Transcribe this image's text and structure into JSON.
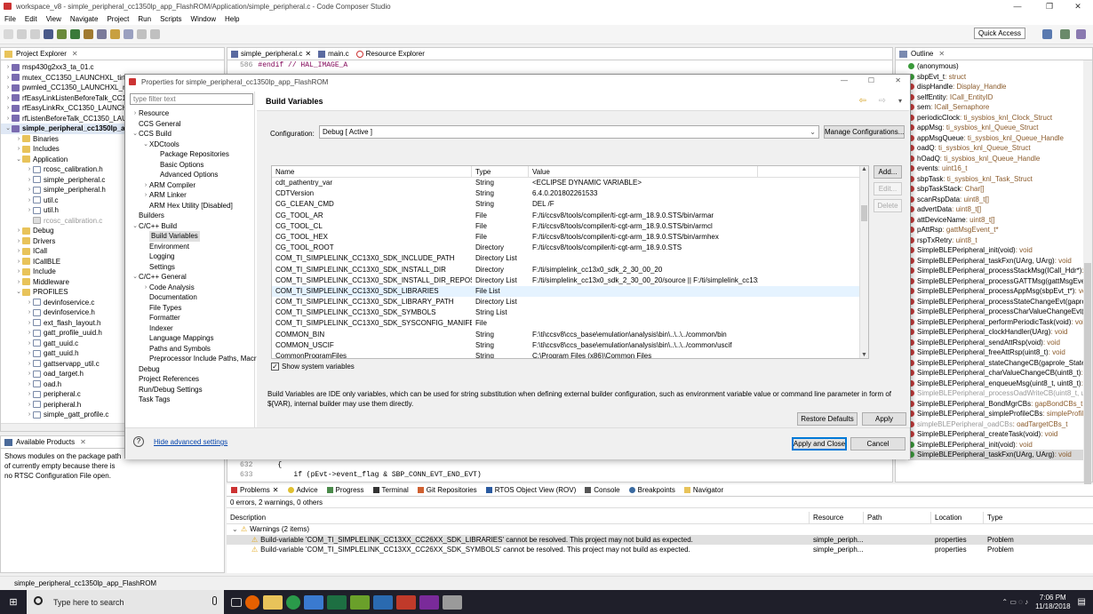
{
  "window": {
    "title": "workspace_v8 - simple_peripheral_cc1350lp_app_FlashROM/Application/simple_peripheral.c - Code Composer Studio"
  },
  "menu": [
    "File",
    "Edit",
    "View",
    "Navigate",
    "Project",
    "Run",
    "Scripts",
    "Window",
    "Help"
  ],
  "quick_access": "Quick Access",
  "project_explorer": {
    "tab": "Project Explorer",
    "items": [
      {
        "label": "msp430g2xx3_ta_01.c",
        "indent": 0,
        "icon": "proj",
        "tw": "›"
      },
      {
        "label": "mutex_CC1350_LAUNCHXL_tirto",
        "indent": 0,
        "icon": "proj",
        "tw": "›"
      },
      {
        "label": "pwmled_CC1350_LAUNCHXL_ne",
        "indent": 0,
        "icon": "proj",
        "tw": "›"
      },
      {
        "label": "rfEasyLinkListenBeforeTalk_CC13",
        "indent": 0,
        "icon": "proj",
        "tw": "›"
      },
      {
        "label": "rfEasyLinkRx_CC1350_LAUNCHX",
        "indent": 0,
        "icon": "proj",
        "tw": "›"
      },
      {
        "label": "rfListenBeforeTalk_CC1350_LAUN",
        "indent": 0,
        "icon": "proj",
        "tw": "›"
      },
      {
        "label": "simple_peripheral_cc1350lp_ap",
        "indent": 0,
        "icon": "proj",
        "tw": "⌄",
        "bold": true
      },
      {
        "label": "Binaries",
        "indent": 1,
        "icon": "folder",
        "tw": "›"
      },
      {
        "label": "Includes",
        "indent": 1,
        "icon": "folder",
        "tw": "›"
      },
      {
        "label": "Application",
        "indent": 1,
        "icon": "folder",
        "tw": "⌄"
      },
      {
        "label": "rcosc_calibration.h",
        "indent": 2,
        "icon": "file",
        "tw": "›"
      },
      {
        "label": "simple_peripheral.c",
        "indent": 2,
        "icon": "file",
        "tw": "›"
      },
      {
        "label": "simple_peripheral.h",
        "indent": 2,
        "icon": "file",
        "tw": "›"
      },
      {
        "label": "util.c",
        "indent": 2,
        "icon": "file",
        "tw": "›"
      },
      {
        "label": "util.h",
        "indent": 2,
        "icon": "file",
        "tw": "›"
      },
      {
        "label": "rcosc_calibration.c",
        "indent": 2,
        "icon": "grey",
        "tw": "",
        "grey": true
      },
      {
        "label": "Debug",
        "indent": 1,
        "icon": "folder",
        "tw": "›"
      },
      {
        "label": "Drivers",
        "indent": 1,
        "icon": "folder",
        "tw": "›"
      },
      {
        "label": "ICall",
        "indent": 1,
        "icon": "folder",
        "tw": "›"
      },
      {
        "label": "ICallBLE",
        "indent": 1,
        "icon": "folder",
        "tw": "›"
      },
      {
        "label": "Include",
        "indent": 1,
        "icon": "folder",
        "tw": "›"
      },
      {
        "label": "Middleware",
        "indent": 1,
        "icon": "folder",
        "tw": "›"
      },
      {
        "label": "PROFILES",
        "indent": 1,
        "icon": "folder",
        "tw": "⌄"
      },
      {
        "label": "devinfoservice.c",
        "indent": 2,
        "icon": "file",
        "tw": "›"
      },
      {
        "label": "devinfoservice.h",
        "indent": 2,
        "icon": "file",
        "tw": "›"
      },
      {
        "label": "ext_flash_layout.h",
        "indent": 2,
        "icon": "file",
        "tw": "›"
      },
      {
        "label": "gatt_profile_uuid.h",
        "indent": 2,
        "icon": "file",
        "tw": "›"
      },
      {
        "label": "gatt_uuid.c",
        "indent": 2,
        "icon": "file",
        "tw": "›"
      },
      {
        "label": "gatt_uuid.h",
        "indent": 2,
        "icon": "file",
        "tw": "›"
      },
      {
        "label": "gattservapp_util.c",
        "indent": 2,
        "icon": "file",
        "tw": "›"
      },
      {
        "label": "oad_target.h",
        "indent": 2,
        "icon": "file",
        "tw": "›"
      },
      {
        "label": "oad.h",
        "indent": 2,
        "icon": "file",
        "tw": "›"
      },
      {
        "label": "peripheral.c",
        "indent": 2,
        "icon": "file",
        "tw": "›"
      },
      {
        "label": "peripheral.h",
        "indent": 2,
        "icon": "file",
        "tw": "›"
      },
      {
        "label": "simple_gatt_profile.c",
        "indent": 2,
        "icon": "file",
        "tw": "›"
      }
    ]
  },
  "available_products": {
    "tab": "Available Products",
    "text": "Shows modules on the package path of currently empty because there is no RTSC Configuration File open."
  },
  "editor": {
    "tabs": [
      "simple_peripheral.c",
      "main.c",
      "Resource Explorer"
    ],
    "top_line_no": "586",
    "top_line": "#endif // HAL_IMAGE_A",
    "bottom_lines": [
      {
        "no": "632",
        "code": "{"
      },
      {
        "no": "633",
        "code": "if (pEvt->event_flag & SBP_CONN_EVT_END_EVT)"
      }
    ]
  },
  "outline": {
    "tab": "Outline",
    "items": [
      {
        "name": "(anonymous)",
        "type": "",
        "dot": "g"
      },
      {
        "name": "sbpEvt_t",
        "type": " : struct",
        "dot": "g"
      },
      {
        "name": "dispHandle",
        "type": " : Display_Handle",
        "dot": "r"
      },
      {
        "name": "selfEntity",
        "type": " : ICall_EntityID",
        "dot": "r"
      },
      {
        "name": "sem",
        "type": " : ICall_Semaphore",
        "dot": "r"
      },
      {
        "name": "periodicClock",
        "type": " : ti_sysbios_knl_Clock_Struct",
        "dot": "r"
      },
      {
        "name": "appMsg",
        "type": " : ti_sysbios_knl_Queue_Struct",
        "dot": "r"
      },
      {
        "name": "appMsgQueue",
        "type": " : ti_sysbios_knl_Queue_Handle",
        "dot": "r"
      },
      {
        "name": "oadQ",
        "type": " : ti_sysbios_knl_Queue_Struct",
        "dot": "r"
      },
      {
        "name": "hOadQ",
        "type": " : ti_sysbios_knl_Queue_Handle",
        "dot": "r"
      },
      {
        "name": "events",
        "type": " : uint16_t",
        "dot": "r"
      },
      {
        "name": "sbpTask",
        "type": " : ti_sysbios_knl_Task_Struct",
        "dot": "r"
      },
      {
        "name": "sbpTaskStack",
        "type": " : Char[]",
        "dot": "r"
      },
      {
        "name": "scanRspData",
        "type": " : uint8_t[]",
        "dot": "r"
      },
      {
        "name": "advertData",
        "type": " : uint8_t[]",
        "dot": "r"
      },
      {
        "name": "attDeviceName",
        "type": " : uint8_t[]",
        "dot": "r"
      },
      {
        "name": "pAttRsp",
        "type": " : gattMsgEvent_t*",
        "dot": "r"
      },
      {
        "name": "rspTxRetry",
        "type": " : uint8_t",
        "dot": "r"
      },
      {
        "name": "SimpleBLEPeripheral_init(void)",
        "type": " : void",
        "dot": "r"
      },
      {
        "name": "SimpleBLEPeripheral_taskFxn(UArg, UArg)",
        "type": " : void",
        "dot": "r"
      },
      {
        "name": "SimpleBLEPeripheral_processStackMsg(ICall_Hdr*)",
        "type": " : uint",
        "dot": "r"
      },
      {
        "name": "SimpleBLEPeripheral_processGATTMsg(gattMsgEvent_",
        "type": "",
        "dot": "r"
      },
      {
        "name": "SimpleBLEPeripheral_processAppMsg(sbpEvt_t*)",
        "type": " : void",
        "dot": "r"
      },
      {
        "name": "SimpleBLEPeripheral_processStateChangeEvt(gaprole_",
        "type": "",
        "dot": "r"
      },
      {
        "name": "SimpleBLEPeripheral_processCharValueChangeEvt(uint8",
        "type": "",
        "dot": "r"
      },
      {
        "name": "SimpleBLEPeripheral_performPeriodicTask(void)",
        "type": " : void",
        "dot": "r"
      },
      {
        "name": "SimpleBLEPeripheral_clockHandler(UArg)",
        "type": " : void",
        "dot": "r"
      },
      {
        "name": "SimpleBLEPeripheral_sendAttRsp(void)",
        "type": " : void",
        "dot": "r"
      },
      {
        "name": "SimpleBLEPeripheral_freeAttRsp(uint8_t)",
        "type": " : void",
        "dot": "r"
      },
      {
        "name": "SimpleBLEPeripheral_stateChangeCB(gaprole_States_t)",
        "type": "",
        "dot": "r"
      },
      {
        "name": "SimpleBLEPeripheral_charValueChangeCB(uint8_t)",
        "type": " : vo",
        "dot": "r"
      },
      {
        "name": "SimpleBLEPeripheral_enqueueMsg(uint8_t, uint8_t)",
        "type": " : v",
        "dot": "r"
      },
      {
        "name": "SimpleBLEPeripheral_processOadWriteCB(uint8_t, uint",
        "type": "",
        "dot": "r",
        "grey": true
      },
      {
        "name": "SimpleBLEPeripheral_BondMgrCBs",
        "type": " : gapBondCBs_t",
        "dot": "r"
      },
      {
        "name": "SimpleBLEPeripheral_simpleProfileCBs",
        "type": " : simpleProfileC",
        "dot": "r"
      },
      {
        "name": "simpleBLEPeripheral_oadCBs",
        "type": " : oadTargetCBs_t",
        "dot": "r",
        "grey": true
      },
      {
        "name": "SimpleBLEPeripheral_createTask(void)",
        "type": " : void",
        "dot": "r"
      },
      {
        "name": "SimpleBLEPeripheral_init(void)",
        "type": " : void",
        "dot": "g"
      },
      {
        "name": "SimpleBLEPeripheral_taskFxn(UArg, UArg)",
        "type": " : void",
        "dot": "g",
        "sel": true
      }
    ]
  },
  "dialog": {
    "title": "Properties for simple_peripheral_cc1350lp_app_FlashROM",
    "filter_placeholder": "type filter text",
    "nav": [
      {
        "label": "Resource",
        "indent": 0,
        "tw": "›"
      },
      {
        "label": "CCS General",
        "indent": 0,
        "tw": ""
      },
      {
        "label": "CCS Build",
        "indent": 0,
        "tw": "⌄"
      },
      {
        "label": "XDCtools",
        "indent": 1,
        "tw": "⌄"
      },
      {
        "label": "Package Repositories",
        "indent": 2,
        "tw": ""
      },
      {
        "label": "Basic Options",
        "indent": 2,
        "tw": ""
      },
      {
        "label": "Advanced Options",
        "indent": 2,
        "tw": ""
      },
      {
        "label": "ARM Compiler",
        "indent": 1,
        "tw": "›"
      },
      {
        "label": "ARM Linker",
        "indent": 1,
        "tw": "›"
      },
      {
        "label": "ARM Hex Utility  [Disabled]",
        "indent": 1,
        "tw": ""
      },
      {
        "label": "Builders",
        "indent": 0,
        "tw": ""
      },
      {
        "label": "C/C++ Build",
        "indent": 0,
        "tw": "⌄"
      },
      {
        "label": "Build Variables",
        "indent": 1,
        "tw": "",
        "sel": true
      },
      {
        "label": "Environment",
        "indent": 1,
        "tw": ""
      },
      {
        "label": "Logging",
        "indent": 1,
        "tw": ""
      },
      {
        "label": "Settings",
        "indent": 1,
        "tw": ""
      },
      {
        "label": "C/C++ General",
        "indent": 0,
        "tw": "⌄"
      },
      {
        "label": "Code Analysis",
        "indent": 1,
        "tw": "›"
      },
      {
        "label": "Documentation",
        "indent": 1,
        "tw": ""
      },
      {
        "label": "File Types",
        "indent": 1,
        "tw": ""
      },
      {
        "label": "Formatter",
        "indent": 1,
        "tw": ""
      },
      {
        "label": "Indexer",
        "indent": 1,
        "tw": ""
      },
      {
        "label": "Language Mappings",
        "indent": 1,
        "tw": ""
      },
      {
        "label": "Paths and Symbols",
        "indent": 1,
        "tw": ""
      },
      {
        "label": "Preprocessor Include Paths, Macr",
        "indent": 1,
        "tw": ""
      },
      {
        "label": "Debug",
        "indent": 0,
        "tw": ""
      },
      {
        "label": "Project References",
        "indent": 0,
        "tw": ""
      },
      {
        "label": "Run/Debug Settings",
        "indent": 0,
        "tw": ""
      },
      {
        "label": "Task Tags",
        "indent": 0,
        "tw": ""
      }
    ],
    "page_title": "Build Variables",
    "config_label": "Configuration:",
    "config_value": "Debug  [ Active ]",
    "manage_btn": "Manage Configurations...",
    "columns": [
      "Name",
      "Type",
      "Value"
    ],
    "rows": [
      {
        "name": "cdt_pathentry_var",
        "type": "String",
        "value": "<ECLIPSE DYNAMIC VARIABLE>"
      },
      {
        "name": "CDTVersion",
        "type": "String",
        "value": "6.4.0.201802261533"
      },
      {
        "name": "CG_CLEAN_CMD",
        "type": "String",
        "value": "DEL /F"
      },
      {
        "name": "CG_TOOL_AR",
        "type": "File",
        "value": "F:/ti/ccsv8/tools/compiler/ti-cgt-arm_18.9.0.STS/bin/armar"
      },
      {
        "name": "CG_TOOL_CL",
        "type": "File",
        "value": "F:/ti/ccsv8/tools/compiler/ti-cgt-arm_18.9.0.STS/bin/armcl"
      },
      {
        "name": "CG_TOOL_HEX",
        "type": "File",
        "value": "F:/ti/ccsv8/tools/compiler/ti-cgt-arm_18.9.0.STS/bin/armhex"
      },
      {
        "name": "CG_TOOL_ROOT",
        "type": "Directory",
        "value": "F:/ti/ccsv8/tools/compiler/ti-cgt-arm_18.9.0.STS"
      },
      {
        "name": "COM_TI_SIMPLELINK_CC13X0_SDK_INCLUDE_PATH",
        "type": "Directory List",
        "value": ""
      },
      {
        "name": "COM_TI_SIMPLELINK_CC13X0_SDK_INSTALL_DIR",
        "type": "Directory",
        "value": "F:/ti/simplelink_cc13x0_sdk_2_30_00_20"
      },
      {
        "name": "COM_TI_SIMPLELINK_CC13X0_SDK_INSTALL_DIR_REPOS",
        "type": "Directory List",
        "value": "F:/ti/simplelink_cc13x0_sdk_2_30_00_20/source || F:/ti/simplelink_cc13x0..."
      },
      {
        "name": "COM_TI_SIMPLELINK_CC13X0_SDK_LIBRARIES",
        "type": "File List",
        "value": "",
        "sel": true
      },
      {
        "name": "COM_TI_SIMPLELINK_CC13X0_SDK_LIBRARY_PATH",
        "type": "Directory List",
        "value": ""
      },
      {
        "name": "COM_TI_SIMPLELINK_CC13X0_SDK_SYMBOLS",
        "type": "String List",
        "value": ""
      },
      {
        "name": "COM_TI_SIMPLELINK_CC13X0_SDK_SYSCONFIG_MANIFEST",
        "type": "File",
        "value": ""
      },
      {
        "name": "COMMON_BIN",
        "type": "String",
        "value": "F:\\ti\\ccsv8\\ccs_base\\emulation\\analysis\\bin\\..\\..\\../common/bin"
      },
      {
        "name": "COMMON_USCIF",
        "type": "String",
        "value": "F:\\ti\\ccsv8\\ccs_base\\emulation\\analysis\\bin\\..\\..\\../common/uscif"
      },
      {
        "name": "CommonProgramFiles",
        "type": "String",
        "value": "C:\\Program Files (x86)\\Common Files"
      }
    ],
    "add_btn": "Add...",
    "edit_btn": "Edit...",
    "delete_btn": "Delete",
    "show_system": "Show system variables",
    "description": "Build Variables are IDE only variables, which can be used for string substitution when defining external builder configuration, such as environment variable value or command line parameter in form of ${VAR), internal builder may use them directly.",
    "restore_btn": "Restore Defaults",
    "apply_btn": "Apply",
    "hide_advanced": "Hide advanced settings",
    "apply_close_btn": "Apply and Close",
    "cancel_btn": "Cancel"
  },
  "problems": {
    "tabs": [
      "Problems",
      "Advice",
      "Progress",
      "Terminal",
      "Git Repositories",
      "RTOS Object View (ROV)",
      "Console",
      "Breakpoints",
      "Navigator"
    ],
    "summary": "0 errors, 2 warnings, 0 others",
    "columns": [
      "Description",
      "Resource",
      "Path",
      "Location",
      "Type"
    ],
    "group": "Warnings (2 items)",
    "rows": [
      {
        "desc": "Build-variable 'COM_TI_SIMPLELINK_CC13XX_CC26XX_SDK_LIBRARIES' cannot be resolved. This project may not build as expected.",
        "resource": "simple_periph...",
        "path": "",
        "location": "properties",
        "type": "Problem"
      },
      {
        "desc": "Build-variable 'COM_TI_SIMPLELINK_CC13XX_CC26XX_SDK_SYMBOLS' cannot be resolved. This project may not build as expected.",
        "resource": "simple_periph...",
        "path": "",
        "location": "properties",
        "type": "Problem"
      }
    ]
  },
  "statusbar": "simple_peripheral_cc1350lp_app_FlashROM",
  "taskbar": {
    "search": "Type here to search",
    "time": "7:06 PM",
    "date": "11/18/2018"
  }
}
